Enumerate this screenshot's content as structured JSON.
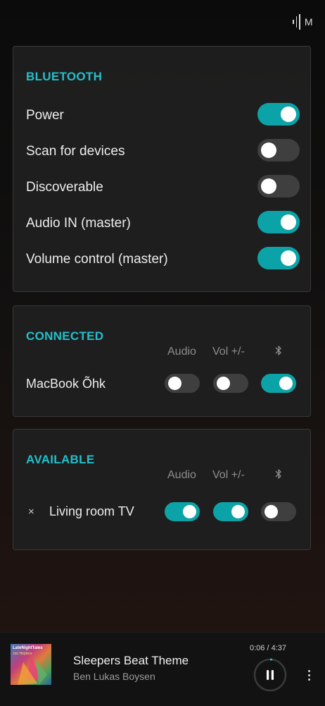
{
  "app": {
    "logo_letter": "M"
  },
  "bluetooth": {
    "title": "BLUETOOTH",
    "rows": [
      {
        "label": "Power",
        "on": true
      },
      {
        "label": "Scan for devices",
        "on": false
      },
      {
        "label": "Discoverable",
        "on": false
      },
      {
        "label": "Audio IN (master)",
        "on": true
      },
      {
        "label": "Volume control (master)",
        "on": true
      }
    ]
  },
  "connected": {
    "title": "CONNECTED",
    "columns": [
      "Audio",
      "Vol +/-"
    ],
    "bt_column_icon": "bluetooth-icon",
    "devices": [
      {
        "name": "MacBook Õhk",
        "audio": false,
        "volume": false,
        "bluetooth": true
      }
    ]
  },
  "available": {
    "title": "AVAILABLE",
    "columns": [
      "Audio",
      "Vol +/-"
    ],
    "bt_column_icon": "bluetooth-icon",
    "remove_symbol": "×",
    "devices": [
      {
        "name": "Living room TV",
        "audio": true,
        "volume": true,
        "bluetooth": false
      }
    ]
  },
  "player": {
    "title": "Sleepers Beat Theme",
    "artist": "Ben Lukas Boysen",
    "time": "0:06 / 4:37",
    "progress": 0.022,
    "cover_brand": "LateNightTales",
    "cover_sub": "Jon Hopkins",
    "state": "playing"
  },
  "colors": {
    "accent": "#23c0cc",
    "toggle_on": "#0ba3a8",
    "toggle_off": "#3f3f3f"
  }
}
